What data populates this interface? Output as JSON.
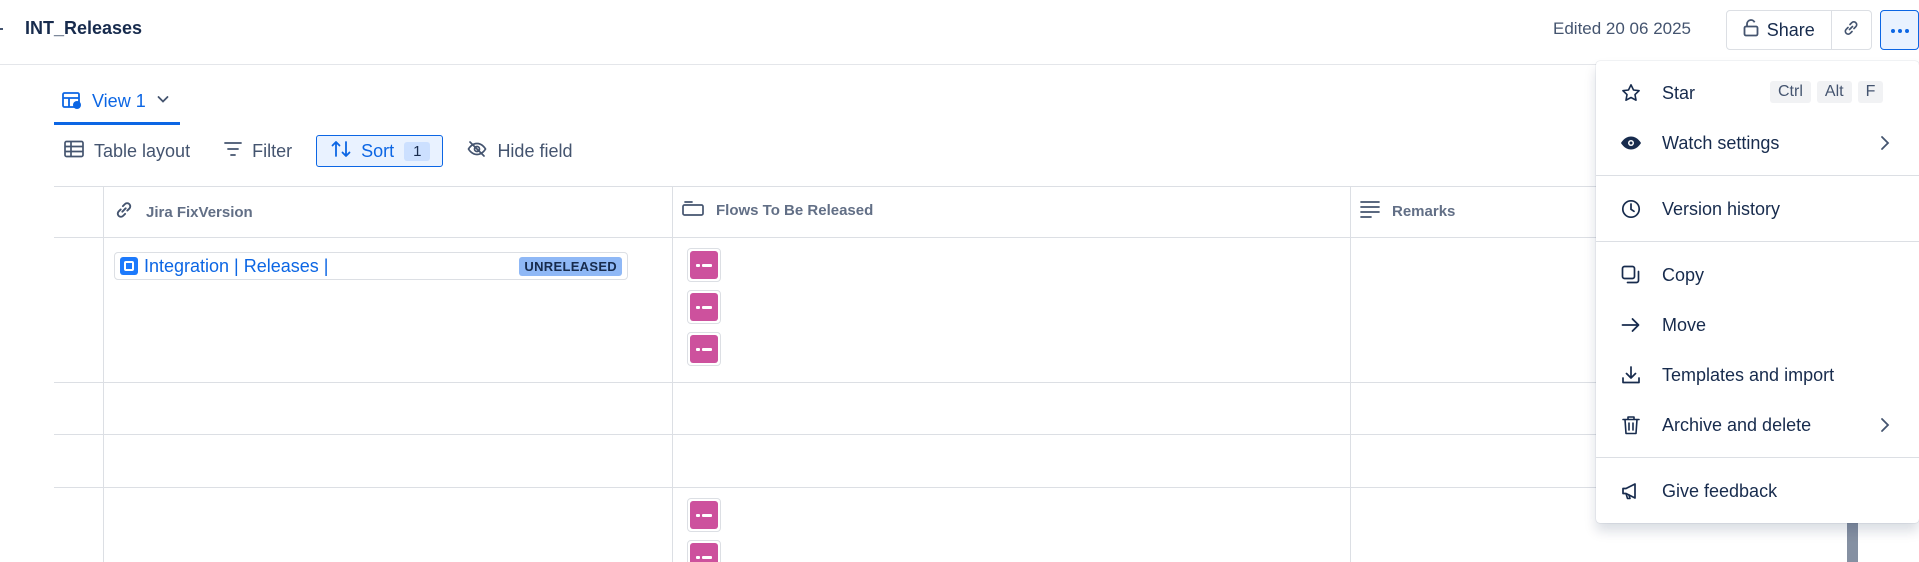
{
  "header": {
    "title": "INT_Releases",
    "edited": "Edited 20 06 2025",
    "share_label": "Share"
  },
  "view": {
    "tab_label": "View 1"
  },
  "toolbar": {
    "table_layout_label": "Table layout",
    "filter_label": "Filter",
    "sort_label": "Sort",
    "sort_count": "1",
    "hide_field_label": "Hide field"
  },
  "table": {
    "columns": [
      {
        "label": "Jira FixVersion",
        "icon": "link-icon"
      },
      {
        "label": "Flows To Be Released",
        "icon": "flow-field-icon"
      },
      {
        "label": "Remarks",
        "icon": "text-lines-icon"
      }
    ],
    "rows": [
      {
        "fix_version": "Integration | Releases |",
        "status": "UNRELEASED",
        "flows": 3
      },
      {
        "fix_version": "",
        "status": "",
        "flows": 0
      },
      {
        "fix_version": "",
        "status": "",
        "flows": 0
      },
      {
        "fix_version": "",
        "status": "",
        "flows": 2
      }
    ]
  },
  "menu": {
    "items": [
      {
        "label": "Star",
        "icon": "star-icon",
        "shortcut": [
          "Ctrl",
          "Alt",
          "F"
        ]
      },
      {
        "label": "Watch settings",
        "icon": "eye-icon",
        "submenu": true
      },
      {
        "label": "Version history",
        "icon": "clock-icon"
      },
      {
        "label": "Copy",
        "icon": "copy-icon"
      },
      {
        "label": "Move",
        "icon": "arrow-right-icon"
      },
      {
        "label": "Templates and import",
        "icon": "download-icon"
      },
      {
        "label": "Archive and delete",
        "icon": "trash-icon",
        "submenu": true
      },
      {
        "label": "Give feedback",
        "icon": "megaphone-icon"
      }
    ]
  },
  "colors": {
    "accent": "#0c66e4",
    "flow_icon": "#cd519d",
    "badge": "#8fb8f6"
  }
}
